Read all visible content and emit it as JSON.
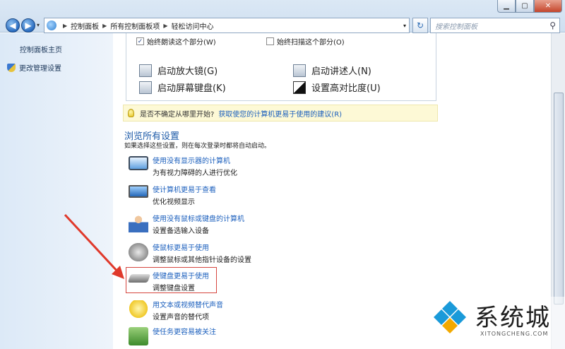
{
  "window": {
    "controls": {
      "minimize": "▁",
      "maximize": "▢",
      "close": "✕"
    }
  },
  "nav": {
    "back": "◀",
    "forward": "▶",
    "history_dropdown": "▾"
  },
  "address_bar": {
    "breadcrumbs": [
      "控制面板",
      "所有控制面板项",
      "轻松访问中心"
    ],
    "dropdown": "▾"
  },
  "refresh": "↻",
  "search": {
    "placeholder": "搜索控制面板",
    "icon": "⚲"
  },
  "sidebar": {
    "home_link": "控制面板主页",
    "admin_link": "更改管理设置"
  },
  "panel": {
    "checkbox_read": {
      "label": "始终朗读这个部分(W)",
      "checked": true
    },
    "checkbox_scan": {
      "label": "始终扫描这个部分(O)",
      "checked": false
    },
    "tools": [
      {
        "label": "启动放大镜(G)",
        "icon": "magnifier-icon"
      },
      {
        "label": "启动讲述人(N)",
        "icon": "narrator-icon"
      },
      {
        "label": "启动屏幕键盘(K)",
        "icon": "onscreen-keyboard-icon"
      },
      {
        "label": "设置高对比度(U)",
        "icon": "high-contrast-icon"
      }
    ]
  },
  "tip": {
    "prefix": "是否不确定从哪里开始?",
    "link": "获取使您的计算机更易于使用的建议(R)"
  },
  "browse": {
    "title": "浏览所有设置",
    "description": "如果选择这些设置，则在每次登录时都将自动启动。",
    "items": [
      {
        "title": "使用没有显示器的计算机",
        "desc": "为有视力障碍的人进行优化",
        "icon": "monitor-icon"
      },
      {
        "title": "使计算机更易于查看",
        "desc": "优化视频显示",
        "icon": "display-icon"
      },
      {
        "title": "使用没有鼠标或键盘的计算机",
        "desc": "设置备选输入设备",
        "icon": "person-icon"
      },
      {
        "title": "使鼠标更易于使用",
        "desc": "调整鼠标或其他指针设备的设置",
        "icon": "mouse-icon"
      },
      {
        "title": "使键盘更易于使用",
        "desc": "调整键盘设置",
        "icon": "keyboard-icon"
      },
      {
        "title": "用文本或视频替代声音",
        "desc": "设置声音的替代项",
        "icon": "speech-bubble-icon"
      },
      {
        "title": "使任务更容易被关注",
        "desc": "",
        "icon": "tasks-icon"
      }
    ]
  },
  "watermark": {
    "text": "系统城",
    "sub": "XITONGCHENG.COM"
  },
  "colors": {
    "link": "#1b5fbd",
    "highlight_box": "#d6463f",
    "arrow": "#e0392b"
  }
}
